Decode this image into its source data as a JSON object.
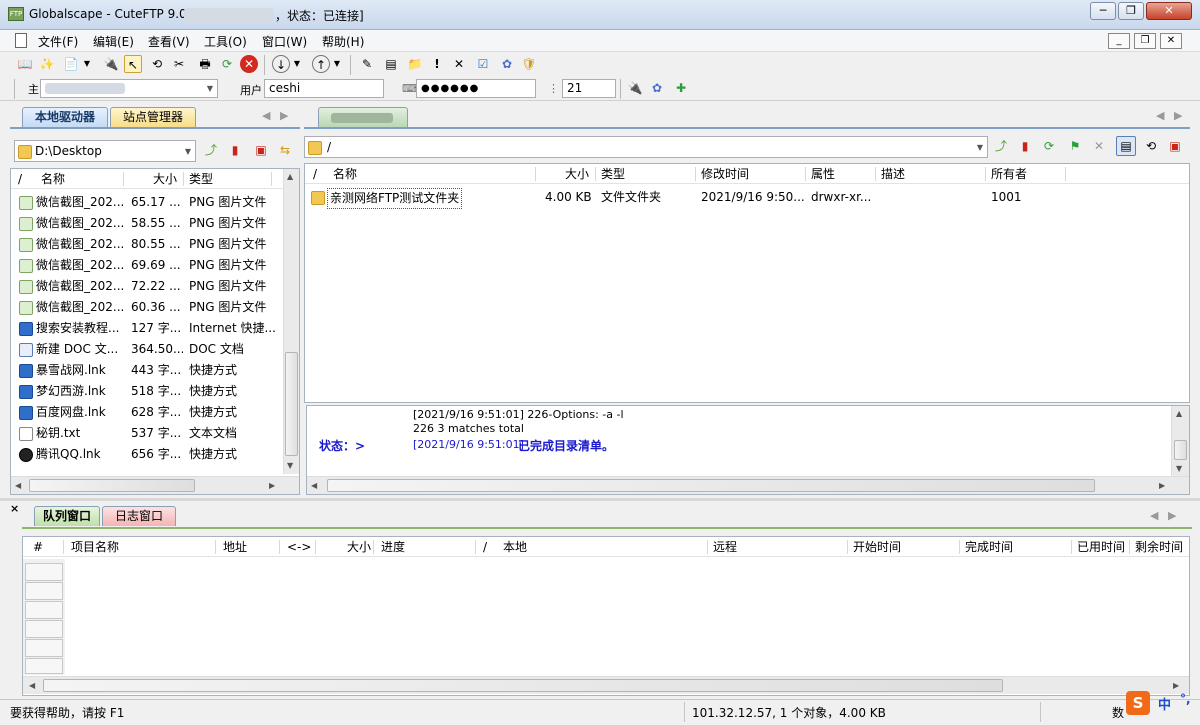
{
  "window": {
    "title": "Globalscape - CuteFTP 9.0",
    "status_suffix": "，状态：已连接]"
  },
  "menu": [
    "文件(F)",
    "编辑(E)",
    "查看(V)",
    "工具(O)",
    "窗口(W)",
    "帮助(H)"
  ],
  "connection": {
    "host_label": "主",
    "user_label": "用户",
    "user_value": "ceshi",
    "password_value": "●●●●●●",
    "port_value": "21"
  },
  "left": {
    "tabs": [
      "本地驱动器",
      "站点管理器"
    ],
    "path": "D:\\Desktop",
    "columns": [
      "/",
      "名称",
      "大小",
      "类型"
    ],
    "files": [
      {
        "icon": "png-file-icon",
        "name": "微信截图_202...",
        "size": "65.17 ...",
        "type": "PNG 图片文件"
      },
      {
        "icon": "png-file-icon",
        "name": "微信截图_202...",
        "size": "58.55 ...",
        "type": "PNG 图片文件"
      },
      {
        "icon": "png-file-icon",
        "name": "微信截图_202...",
        "size": "80.55 ...",
        "type": "PNG 图片文件"
      },
      {
        "icon": "png-file-icon",
        "name": "微信截图_202...",
        "size": "69.69 ...",
        "type": "PNG 图片文件"
      },
      {
        "icon": "png-file-icon",
        "name": "微信截图_202...",
        "size": "72.22 ...",
        "type": "PNG 图片文件"
      },
      {
        "icon": "png-file-icon",
        "name": "微信截图_202...",
        "size": "60.36 ...",
        "type": "PNG 图片文件"
      },
      {
        "icon": "internet-shortcut-icon",
        "name": "搜索安装教程...",
        "size": "127 字...",
        "type": "Internet 快捷..."
      },
      {
        "icon": "doc-file-icon",
        "name": "新建 DOC 文...",
        "size": "364.50...",
        "type": "DOC 文档"
      },
      {
        "icon": "shortcut-icon",
        "name": "暴雪战网.lnk",
        "size": "443 字...",
        "type": "快捷方式"
      },
      {
        "icon": "shortcut-icon",
        "name": "梦幻西游.lnk",
        "size": "518 字...",
        "type": "快捷方式"
      },
      {
        "icon": "shortcut-icon",
        "name": "百度网盘.lnk",
        "size": "628 字...",
        "type": "快捷方式"
      },
      {
        "icon": "txt-file-icon",
        "name": "秘钥.txt",
        "size": "537 字...",
        "type": "文本文档"
      },
      {
        "icon": "qq-shortcut-icon",
        "name": "腾讯QQ.lnk",
        "size": "656 字...",
        "type": "快捷方式"
      }
    ]
  },
  "remote": {
    "path": "/",
    "columns": [
      "/",
      "名称",
      "大小",
      "类型",
      "修改时间",
      "属性",
      "描述",
      "所有者"
    ],
    "files": [
      {
        "name": "亲测网络FTP测试文件夹",
        "size": "4.00 KB",
        "type": "文件文件夹",
        "modified": "2021/9/16 9:50...",
        "attrs": "drwxr-xr...",
        "desc": "",
        "owner": "1001"
      }
    ]
  },
  "log": {
    "line1": "[2021/9/16 9:51:01] 226-Options: -a -l",
    "line2": "226 3 matches total",
    "status_label": "状态：>",
    "line3_time": "[2021/9/16 9:51:01]",
    "line3_msg": "已完成目录清单。"
  },
  "queue": {
    "tabs": [
      "队列窗口",
      "日志窗口"
    ],
    "columns": [
      "#",
      "项目名称",
      "地址",
      "<->",
      "大小",
      "进度",
      "/",
      "本地",
      "远程",
      "开始时间",
      "完成时间",
      "已用时间",
      "剩余时间"
    ]
  },
  "statusbar": {
    "help": "要获得帮助，请按 F1",
    "info": "101.32.12.57, 1 个对象，4.00 KB",
    "ime": "中",
    "num": "数"
  }
}
